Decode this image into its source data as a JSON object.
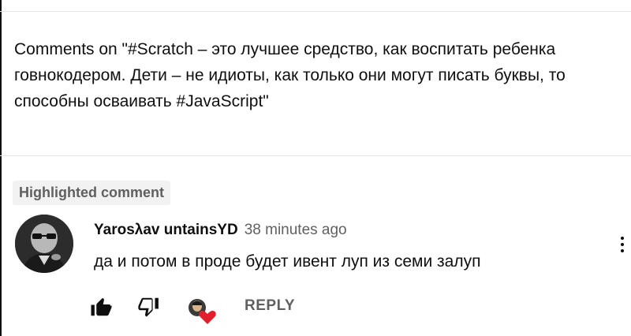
{
  "header": {
    "title": "Comments on \"#Scratch – это лучшее средство, как воспитать ребенка говнокодером. Дети – не идиоты, как только они могут писать буквы, то способны осваивать #JavaScript\""
  },
  "highlight_label": "Highlighted comment",
  "comment": {
    "author": "Yarosλav untainsYD",
    "time": "38 minutes ago",
    "text": "да и потом в проде будет ивент луп из семи залуп",
    "reply_label": "REPLY"
  },
  "icons": {
    "like": "thumb-up-filled-icon",
    "dislike": "thumb-down-outline-icon",
    "creator_heart": "creator-heart-icon",
    "menu": "more-vertical-icon"
  },
  "colors": {
    "heart": "#e0202a",
    "secondary_text": "#606060",
    "chip_bg": "#f2f2f2"
  }
}
